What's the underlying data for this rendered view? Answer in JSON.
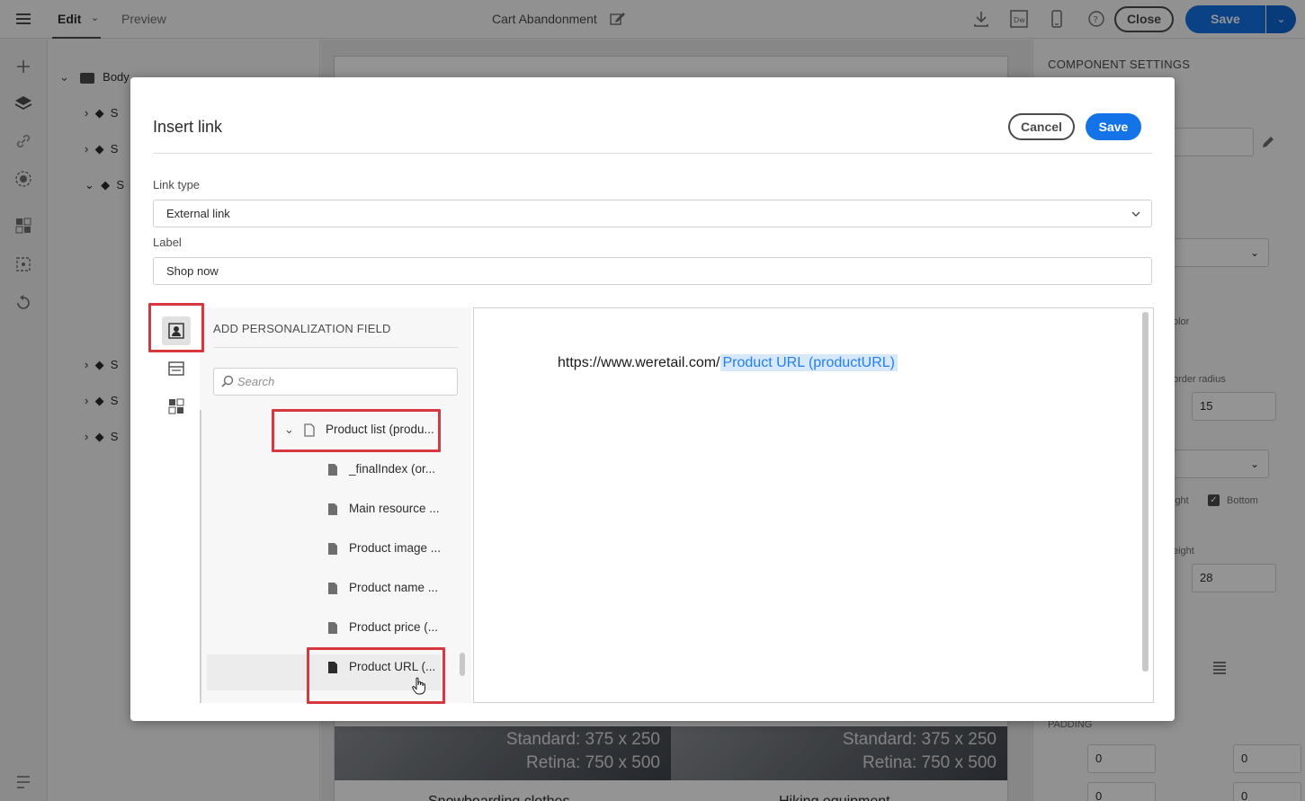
{
  "topbar": {
    "tab_edit": "Edit",
    "tab_preview": "Preview",
    "document_title": "Cart Abandonment",
    "close_label": "Close",
    "save_label": "Save"
  },
  "tree": {
    "root_label": "Body",
    "rows": [
      "S",
      "S",
      "S",
      "S",
      "S",
      "S"
    ]
  },
  "canvas": {
    "images": [
      {
        "line1": "Standard: 375 x 250",
        "line2": "Retina: 750 x 500",
        "caption": "Snowboarding clothes"
      },
      {
        "line1": "Standard: 375 x 250",
        "line2": "Retina: 750 x 500",
        "caption": "Hiking equipment"
      }
    ]
  },
  "settings": {
    "title": "COMPONENT SETTINGS",
    "color_label": "olor",
    "border_radius_label": "order radius",
    "border_radius_value": "15",
    "right_label": "ight",
    "bottom_label": "Bottom",
    "height_label": "eight",
    "height_value": "28",
    "padding_label": "PADDING",
    "padding_values": [
      "0",
      "0",
      "0",
      "0"
    ]
  },
  "modal": {
    "title": "Insert link",
    "cancel_label": "Cancel",
    "save_label": "Save",
    "link_type_label": "Link type",
    "link_type_value": "External link",
    "label_label": "Label",
    "label_value": "Shop now",
    "personalization": {
      "title": "ADD PERSONALIZATION FIELD",
      "search_placeholder": "Search",
      "items": [
        {
          "label": "Product list (produ...",
          "expanded": true,
          "level": 0
        },
        {
          "label": "_finalIndex (or...",
          "level": 1
        },
        {
          "label": "Main resource ...",
          "level": 1
        },
        {
          "label": "Product image ...",
          "level": 1
        },
        {
          "label": "Product name ...",
          "level": 1
        },
        {
          "label": "Product price (...",
          "level": 1
        },
        {
          "label": "Product URL (...",
          "level": 1,
          "selected": true
        }
      ]
    },
    "editor": {
      "url_prefix": "https://www.weretail.com/",
      "token": "Product URL (productURL)"
    }
  },
  "colors": {
    "accent": "#1473e6",
    "highlight": "#d7373f",
    "token_bg": "#d6e8fa",
    "token_text": "#2680eb"
  }
}
